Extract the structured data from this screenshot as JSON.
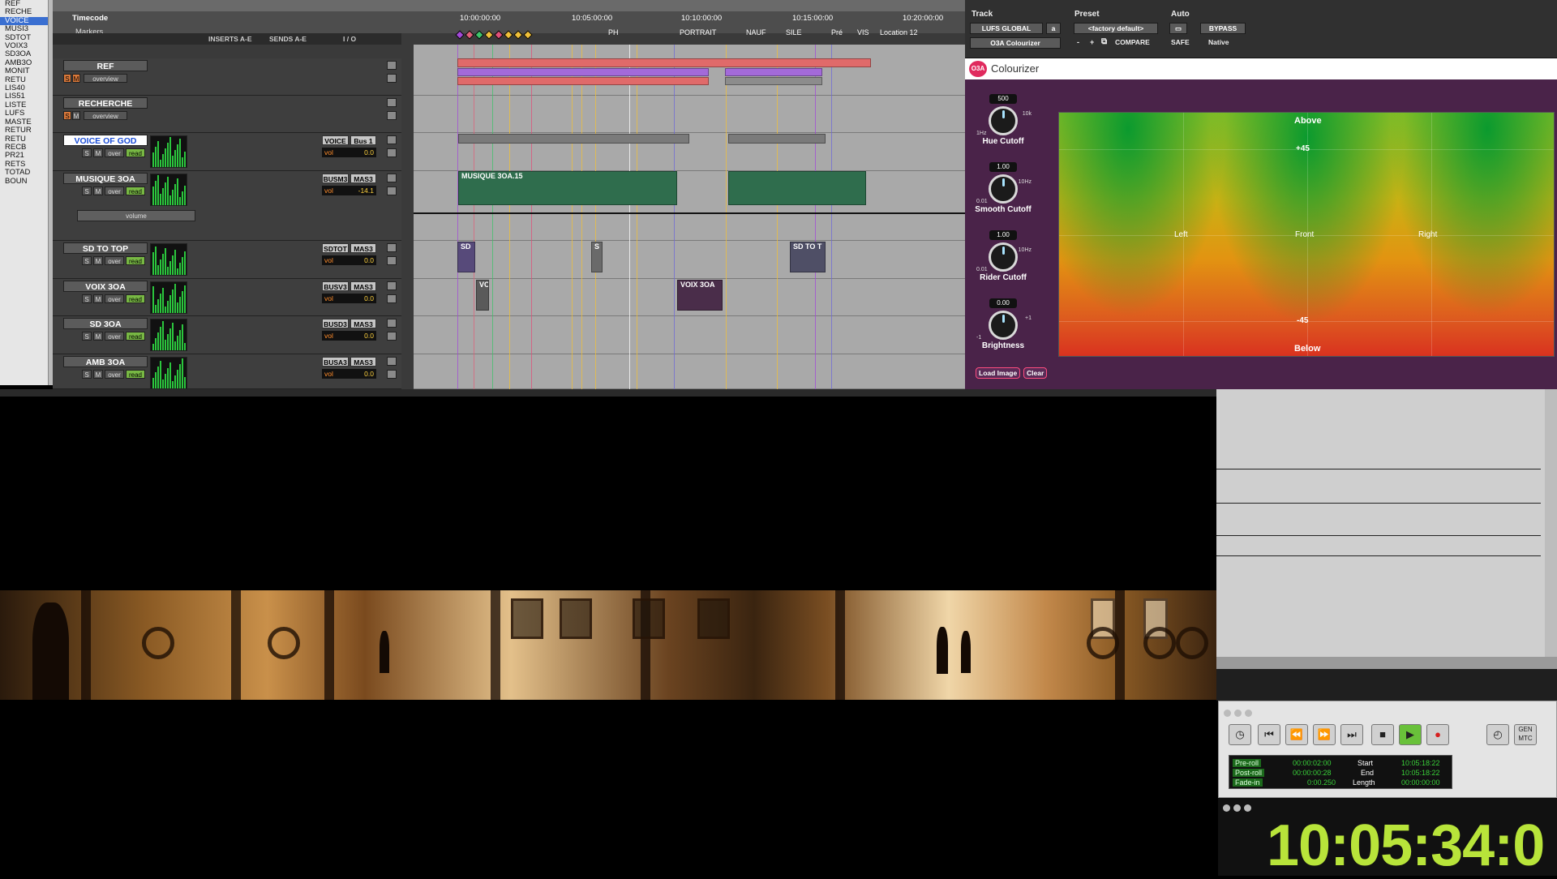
{
  "tracklist": [
    "REF",
    "RECHE",
    "VOICE",
    "MUSI3",
    "SDTOT",
    "VOIX3",
    "SD3OA",
    "AMB3O",
    "MONIT",
    "RETU",
    "LIS40",
    "LIS51",
    "LISTE",
    "LUFS",
    "MASTE",
    "RETUR",
    "RETU",
    "RECB",
    "PR21",
    "RETS",
    "TOTAD",
    "BOUN"
  ],
  "rulers": {
    "timecode_label": "Timecode",
    "markers_label": "Markers",
    "times": [
      "10:00:00:00",
      "10:05:00:00",
      "10:10:00:00",
      "10:15:00:00",
      "10:20:00:00"
    ],
    "markers": [
      "PH",
      "PORTRAIT",
      "NAUF",
      "SILE",
      "Pré",
      "VIS",
      "Location 12"
    ]
  },
  "columns": {
    "inserts": "INSERTS A-E",
    "sends": "SENDS A-E",
    "io": "I / O"
  },
  "tracks": [
    {
      "name": "REF",
      "mode": "overview",
      "input": "",
      "output": "",
      "vol": ""
    },
    {
      "name": "RECHERCHE",
      "mode": "overview",
      "input": "",
      "output": "",
      "vol": ""
    },
    {
      "name": "VOICE OF GOD",
      "mode": "over",
      "auto": "read",
      "input": "VOICE",
      "output": "Bus 1",
      "vol_label": "vol",
      "vol": "0.0"
    },
    {
      "name": "MUSIQUE 3OA",
      "mode": "over",
      "auto": "read",
      "input": "BUSM3",
      "output": "MAS3",
      "vol_label": "vol",
      "vol": "-14.1",
      "lane": "volume"
    },
    {
      "name": "SD TO TOP",
      "mode": "over",
      "auto": "read",
      "input": "SDTOT",
      "output": "MAS3",
      "vol_label": "vol",
      "vol": "0.0"
    },
    {
      "name": "VOIX 3OA",
      "mode": "over",
      "auto": "read",
      "input": "BUSV3",
      "output": "MAS3",
      "vol_label": "vol",
      "vol": "0.0"
    },
    {
      "name": "SD 3OA",
      "mode": "over",
      "auto": "read",
      "input": "BUSD3",
      "output": "MAS3",
      "vol_label": "vol",
      "vol": "0.0"
    },
    {
      "name": "AMB 3OA",
      "mode": "over",
      "auto": "read",
      "input": "BUSA3",
      "output": "MAS3",
      "vol_label": "vol",
      "vol": "0.0"
    }
  ],
  "clips": {
    "musique": "MUSIQUE 3OA.15",
    "sd1": "SD",
    "sd2": "S",
    "sd3": "SD TO T",
    "voix1": "VC",
    "voix2": "VOIX 3OA"
  },
  "plugin_header": {
    "track_label": "Track",
    "preset_label": "Preset",
    "auto_label": "Auto",
    "track_name": "LUFS GLOBAL",
    "track_suffix": "a",
    "preset": "<factory default>",
    "bypass": "BYPASS",
    "plugin_name": "O3A Colourizer",
    "minus": "-",
    "plus": "+",
    "compare": "COMPARE",
    "safe": "SAFE",
    "native": "Native"
  },
  "colourizer": {
    "logo": "O3A",
    "title": "Colourizer",
    "knobs": [
      {
        "value": "500",
        "label": "Hue Cutoff",
        "min": "1Hz",
        "max": "10k"
      },
      {
        "value": "1.00",
        "label": "Smooth Cutoff",
        "min": "0.01",
        "max": "10Hz"
      },
      {
        "value": "1.00",
        "label": "Rider Cutoff",
        "min": "0.01",
        "max": "10Hz"
      },
      {
        "value": "0.00",
        "label": "Brightness",
        "min": "-1",
        "max": "+1"
      }
    ],
    "field": {
      "above": "Above",
      "below": "Below",
      "left": "Left",
      "front": "Front",
      "right": "Right",
      "plus45": "+45",
      "minus45": "-45"
    },
    "load_image": "Load Image",
    "clear": "Clear"
  },
  "transport": {
    "preroll_label": "Pre-roll",
    "preroll": "00:00:02:00",
    "postroll_label": "Post-roll",
    "postroll": "00:00:00:28",
    "fadein_label": "Fade-in",
    "fadein": "0:00.250",
    "start_label": "Start",
    "start": "10:05:18:22",
    "end_label": "End",
    "end": "10:05:18:22",
    "length_label": "Length",
    "length": "00:00:00:00",
    "gen_mtc": "GEN MTC"
  },
  "big_counter": "10:05:34:0"
}
